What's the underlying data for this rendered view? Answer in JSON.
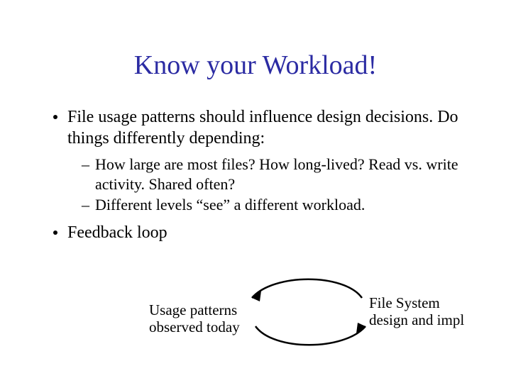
{
  "title": "Know your Workload!",
  "bullets": {
    "b1": "File usage patterns should influence design decisions. Do things differently depending:",
    "sub1": "How large are most files? How long-lived? Read vs. write activity. Shared often?",
    "sub2": "Different levels “see” a different workload.",
    "b2": "Feedback loop"
  },
  "loop": {
    "left_line1": "Usage patterns",
    "left_line2": "observed today",
    "right_line1": "File System",
    "right_line2": "design and impl"
  }
}
